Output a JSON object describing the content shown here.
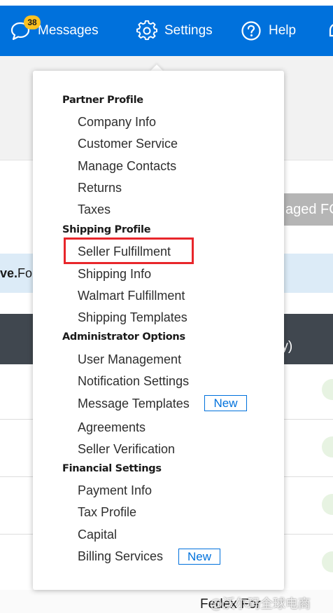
{
  "nav": {
    "messages_label": "Messages",
    "messages_count": "38",
    "settings_label": "Settings",
    "help_label": "Help"
  },
  "background": {
    "button_partial": "aged FC",
    "alert_bold": "ve.",
    "alert_text": " Fo",
    "header_partial": "ry)",
    "carrier_partial": "Fedex For"
  },
  "menu": {
    "partner_profile": {
      "title": "Partner Profile",
      "items": [
        "Company Info",
        "Customer Service",
        "Manage Contacts",
        "Returns",
        "Taxes"
      ]
    },
    "shipping_profile": {
      "title": "Shipping Profile",
      "items": [
        "Seller Fulfillment",
        "Shipping Info",
        "Walmart Fulfillment",
        "Shipping Templates"
      ]
    },
    "administrator_options": {
      "title": "Administrator Options",
      "items": [
        "User Management",
        "Notification Settings",
        "Message Templates",
        "Agreements",
        "Seller Verification"
      ],
      "new_tag": "New"
    },
    "financial_settings": {
      "title": "Financial Settings",
      "items": [
        "Payment Info",
        "Tax Profile",
        "Capital",
        "Billing Services"
      ],
      "new_tag": "New"
    }
  },
  "highlight": {
    "target": "Seller Fulfillment",
    "color": "#e8262b"
  },
  "watermark": "@沃尔玛全球电商",
  "colors": {
    "brand_blue": "#0071dc",
    "badge_yellow": "#ffc220",
    "header_dark": "#40474f"
  }
}
